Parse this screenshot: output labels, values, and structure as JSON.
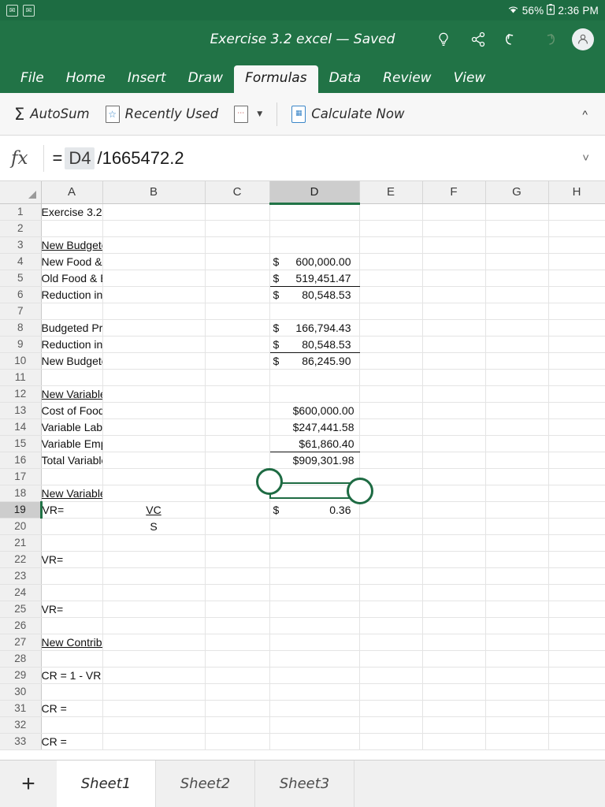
{
  "statusbar": {
    "app_icons": [
      "mail-icon",
      "mail-icon"
    ],
    "wifi_icon": "wifi-icon",
    "battery_text": "56%",
    "battery_icon": "battery-icon",
    "time": "2:36 PM"
  },
  "titlebar": {
    "title": "Exercise 3.2 excel — Saved",
    "icons": [
      "lightbulb-icon",
      "share-icon",
      "undo-icon",
      "redo-icon",
      "account-avatar"
    ]
  },
  "tabs": [
    {
      "label": "File",
      "active": false
    },
    {
      "label": "Home",
      "active": false
    },
    {
      "label": "Insert",
      "active": false
    },
    {
      "label": "Draw",
      "active": false
    },
    {
      "label": "Formulas",
      "active": true
    },
    {
      "label": "Data",
      "active": false
    },
    {
      "label": "Review",
      "active": false
    },
    {
      "label": "View",
      "active": false
    }
  ],
  "ribbon": {
    "autosum": "AutoSum",
    "recently_used": "Recently Used",
    "calculate_now": "Calculate Now",
    "collapse_icon": "chevron-up-icon"
  },
  "formula_bar": {
    "fx_label": "fx",
    "equals": "=",
    "reference": "D4",
    "rest": "/1665472.2",
    "expand_icon": "chevron-down-icon"
  },
  "grid": {
    "columns": [
      "A",
      "B",
      "C",
      "D",
      "E",
      "F",
      "G",
      "H"
    ],
    "selected_column": "D",
    "selected_row": 19,
    "rows": [
      {
        "n": 1,
        "A": "Exercise 3.2"
      },
      {
        "n": 2
      },
      {
        "n": 3,
        "A": "New Budgeted Profit",
        "A_underline": true
      },
      {
        "n": 4,
        "A": "New Food & Beverage Cost",
        "D": "$ 600,000.00",
        "D_acct": [
          "$",
          "600,000.00"
        ]
      },
      {
        "n": 5,
        "A": "Old Food & Beverage Cost",
        "D": "$ 519,451.47",
        "D_acct": [
          "$",
          "519,451.47"
        ],
        "D_border": true
      },
      {
        "n": 6,
        "A": "Reduction in Profit",
        "D": "$   80,548.53",
        "D_acct": [
          "$",
          "80,548.53"
        ]
      },
      {
        "n": 7
      },
      {
        "n": 8,
        "A": "Budgeted Profit",
        "D": "$ 166,794.43",
        "D_acct": [
          "$",
          "166,794.43"
        ]
      },
      {
        "n": 9,
        "A": "Reduction in Profit",
        "D": "$   80,548.53",
        "D_acct": [
          "$",
          "80,548.53"
        ],
        "D_border": true
      },
      {
        "n": 10,
        "A": "New Budgeted Profit",
        "D": "$   86,245.90",
        "D_acct": [
          "$",
          "86,245.90"
        ]
      },
      {
        "n": 11
      },
      {
        "n": 12,
        "A": "New Variable Rate",
        "A_underline": true
      },
      {
        "n": 13,
        "A": "Cost of Food and Beverage",
        "D": "$600,000.00"
      },
      {
        "n": 14,
        "A": "Variable Labor Cost",
        "D": "$247,441.58"
      },
      {
        "n": 15,
        "A": "Variable Employee Benefits",
        "D": "$61,860.40",
        "D_border": true
      },
      {
        "n": 16,
        "A": "Total Variable Costs",
        "D": "$909,301.98"
      },
      {
        "n": 17
      },
      {
        "n": 18,
        "A": "New Variable Rate",
        "A_underline": true
      },
      {
        "n": 19,
        "A": "VR=",
        "B": "VC",
        "B_underline": true,
        "B_center": true,
        "D_acct": [
          "$",
          "0.36"
        ]
      },
      {
        "n": 20,
        "B": "S",
        "B_center": true
      },
      {
        "n": 21
      },
      {
        "n": 22,
        "A": "VR="
      },
      {
        "n": 23
      },
      {
        "n": 24
      },
      {
        "n": 25,
        "A": "VR="
      },
      {
        "n": 26
      },
      {
        "n": 27,
        "A": "New Contribution Rate",
        "A_underline": true
      },
      {
        "n": 28
      },
      {
        "n": 29,
        "A": "CR = 1 - VR"
      },
      {
        "n": 30
      },
      {
        "n": 31,
        "A": "CR ="
      },
      {
        "n": 32
      },
      {
        "n": 33,
        "A": "CR ="
      }
    ]
  },
  "sheetbar": {
    "add_label": "+",
    "sheets": [
      {
        "label": "Sheet1",
        "active": true
      },
      {
        "label": "Sheet2",
        "active": false
      },
      {
        "label": "Sheet3",
        "active": false
      }
    ]
  },
  "colors": {
    "excel_green": "#217346",
    "statusbar_green": "#1d6c42",
    "selection_green": "#1e6b43"
  }
}
